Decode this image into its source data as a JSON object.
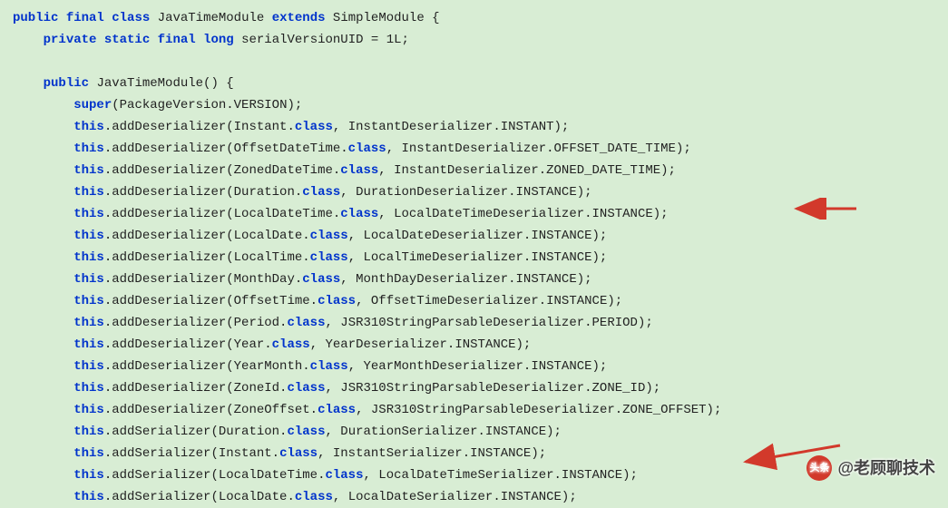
{
  "code": {
    "line1": {
      "t1": "public",
      "t2": "final",
      "t3": "class",
      "name": "JavaTimeModule",
      "t4": "extends",
      "super": "SimpleModule {"
    },
    "line2": {
      "t1": "private",
      "t2": "static",
      "t3": "final",
      "t4": "long",
      "var": "serialVersionUID = 1L;"
    },
    "line3": {
      "t1": "public",
      "name": "JavaTimeModule() {"
    },
    "line4": {
      "t1": "super",
      "rest": "(PackageVersion.VERSION);"
    },
    "line5": {
      "t1": "this",
      "mid": ".addDeserializer(Instant.",
      "t2": "class",
      "rest": ", InstantDeserializer.INSTANT);"
    },
    "line6": {
      "t1": "this",
      "mid": ".addDeserializer(OffsetDateTime.",
      "t2": "class",
      "rest": ", InstantDeserializer.OFFSET_DATE_TIME);"
    },
    "line7": {
      "t1": "this",
      "mid": ".addDeserializer(ZonedDateTime.",
      "t2": "class",
      "rest": ", InstantDeserializer.ZONED_DATE_TIME);"
    },
    "line8": {
      "t1": "this",
      "mid": ".addDeserializer(Duration.",
      "t2": "class",
      "rest": ", DurationDeserializer.INSTANCE);"
    },
    "line9": {
      "t1": "this",
      "mid": ".addDeserializer(LocalDateTime.",
      "t2": "class",
      "rest": ", LocalDateTimeDeserializer.INSTANCE);"
    },
    "line10": {
      "t1": "this",
      "mid": ".addDeserializer(LocalDate.",
      "t2": "class",
      "rest": ", LocalDateDeserializer.INSTANCE);"
    },
    "line11": {
      "t1": "this",
      "mid": ".addDeserializer(LocalTime.",
      "t2": "class",
      "rest": ", LocalTimeDeserializer.INSTANCE);"
    },
    "line12": {
      "t1": "this",
      "mid": ".addDeserializer(MonthDay.",
      "t2": "class",
      "rest": ", MonthDayDeserializer.INSTANCE);"
    },
    "line13": {
      "t1": "this",
      "mid": ".addDeserializer(OffsetTime.",
      "t2": "class",
      "rest": ", OffsetTimeDeserializer.INSTANCE);"
    },
    "line14": {
      "t1": "this",
      "mid": ".addDeserializer(Period.",
      "t2": "class",
      "rest": ", JSR310StringParsableDeserializer.PERIOD);"
    },
    "line15": {
      "t1": "this",
      "mid": ".addDeserializer(Year.",
      "t2": "class",
      "rest": ", YearDeserializer.INSTANCE);"
    },
    "line16": {
      "t1": "this",
      "mid": ".addDeserializer(YearMonth.",
      "t2": "class",
      "rest": ", YearMonthDeserializer.INSTANCE);"
    },
    "line17": {
      "t1": "this",
      "mid": ".addDeserializer(ZoneId.",
      "t2": "class",
      "rest": ", JSR310StringParsableDeserializer.ZONE_ID);"
    },
    "line18": {
      "t1": "this",
      "mid": ".addDeserializer(ZoneOffset.",
      "t2": "class",
      "rest": ", JSR310StringParsableDeserializer.ZONE_OFFSET);"
    },
    "line19": {
      "t1": "this",
      "mid": ".addSerializer(Duration.",
      "t2": "class",
      "rest": ", DurationSerializer.INSTANCE);"
    },
    "line20": {
      "t1": "this",
      "mid": ".addSerializer(Instant.",
      "t2": "class",
      "rest": ", InstantSerializer.INSTANCE);"
    },
    "line21": {
      "t1": "this",
      "mid": ".addSerializer(LocalDateTime.",
      "t2": "class",
      "rest": ", LocalDateTimeSerializer.INSTANCE);"
    },
    "line22": {
      "t1": "this",
      "mid": ".addSerializer(LocalDate.",
      "t2": "class",
      "rest": ", LocalDateSerializer.INSTANCE);"
    }
  },
  "watermark": {
    "logo_text": "头条",
    "text": "@老顾聊技术"
  },
  "arrows": {
    "color": "#d2392b"
  }
}
